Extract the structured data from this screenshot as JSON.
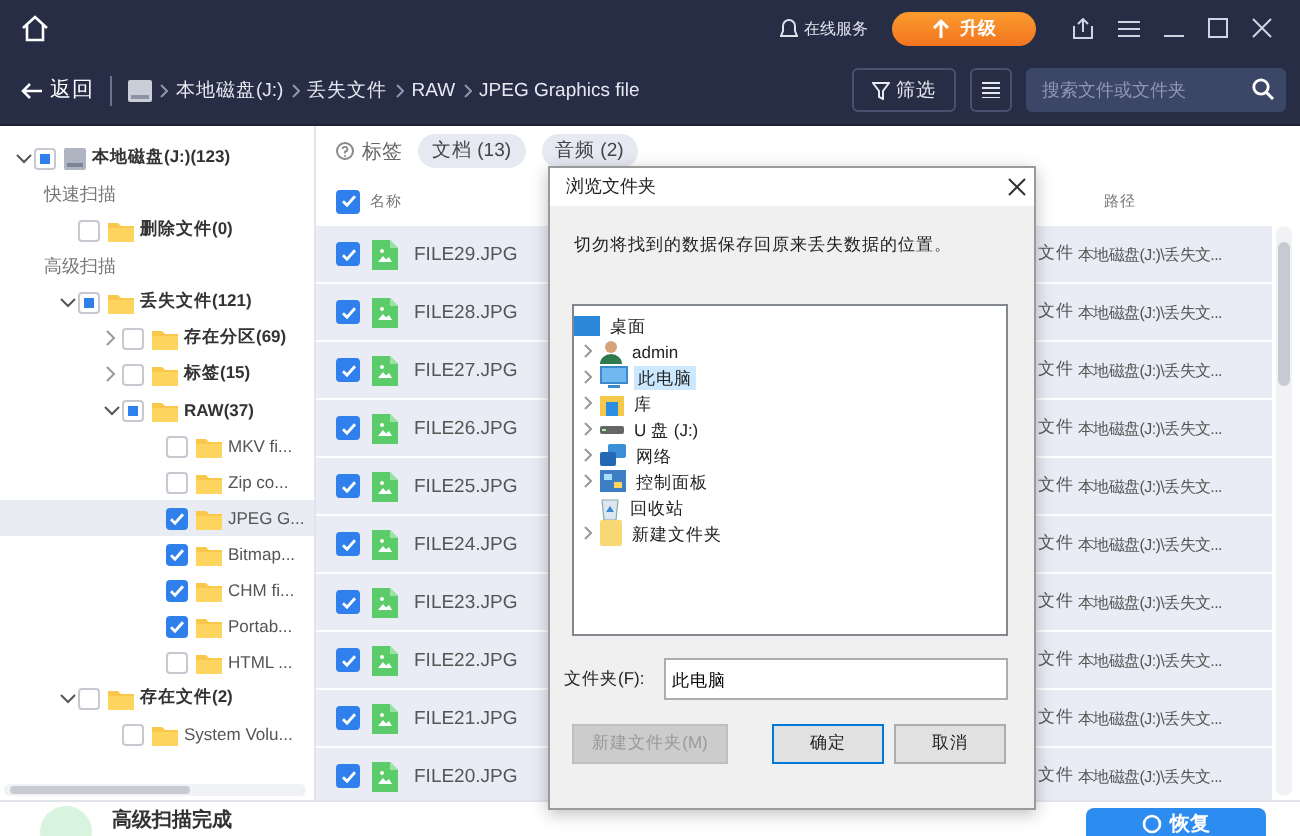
{
  "title_bar": {
    "service_label": "在线服务",
    "upgrade_button": "升级"
  },
  "nav": {
    "back": "返回",
    "breadcrumb": [
      "本地磁盘(J:)",
      "丢失文件",
      "RAW",
      "JPEG Graphics file"
    ],
    "filter_button": "筛选",
    "search": {
      "placeholder": "搜索文件或文件夹"
    }
  },
  "sidebar": {
    "root": {
      "label": "本地磁盘(J:)(123)",
      "checked": false,
      "partial": true,
      "expanded": true,
      "selected": false
    },
    "sections": [
      {
        "title": "快速扫描",
        "items": [
          {
            "label": "删除文件(0)",
            "checked": false,
            "partial": false,
            "selected": false
          }
        ]
      },
      {
        "title": "高级扫描",
        "items": [
          {
            "label": "丢失文件(121)",
            "checked": false,
            "partial": true,
            "expanded": true,
            "selected": false,
            "children": [
              {
                "label": "存在分区(69)",
                "checked": false,
                "partial": false,
                "expanded": false,
                "selected": false
              },
              {
                "label": "标签(15)",
                "checked": false,
                "partial": false,
                "expanded": false,
                "selected": false
              },
              {
                "label": "RAW(37)",
                "checked": false,
                "partial": true,
                "expanded": true,
                "selected": false,
                "children": [
                  {
                    "label": "MKV fi...",
                    "checked": false,
                    "partial": false,
                    "selected": false
                  },
                  {
                    "label": "Zip co...",
                    "checked": false,
                    "partial": false,
                    "selected": false
                  },
                  {
                    "label": "JPEG G...",
                    "checked": true,
                    "partial": false,
                    "selected": true
                  },
                  {
                    "label": "Bitmap...",
                    "checked": true,
                    "partial": false,
                    "selected": false
                  },
                  {
                    "label": "CHM fi...",
                    "checked": true,
                    "partial": false,
                    "selected": false
                  },
                  {
                    "label": "Portab...",
                    "checked": true,
                    "partial": false,
                    "selected": false
                  },
                  {
                    "label": "HTML ...",
                    "checked": false,
                    "partial": false,
                    "selected": false
                  }
                ]
              }
            ]
          },
          {
            "label": "存在文件(2)",
            "checked": false,
            "partial": false,
            "expanded": true,
            "selected": false,
            "children": [
              {
                "label": "System Volu...",
                "checked": false,
                "partial": false,
                "selected": false
              }
            ]
          }
        ]
      }
    ]
  },
  "tags": {
    "label": "标签",
    "chips": [
      "文档 (13)",
      "音频 (2)"
    ]
  },
  "table": {
    "select_all": true,
    "columns": {
      "name": "名称",
      "path": "路径"
    },
    "rows": [
      {
        "checked": true,
        "name": "FILE29.JPG",
        "type": "文件",
        "path": "本地磁盘(J:)\\丢失文..."
      },
      {
        "checked": true,
        "name": "FILE28.JPG",
        "type": "文件",
        "path": "本地磁盘(J:)\\丢失文..."
      },
      {
        "checked": true,
        "name": "FILE27.JPG",
        "type": "文件",
        "path": "本地磁盘(J:)\\丢失文..."
      },
      {
        "checked": true,
        "name": "FILE26.JPG",
        "type": "文件",
        "path": "本地磁盘(J:)\\丢失文..."
      },
      {
        "checked": true,
        "name": "FILE25.JPG",
        "type": "文件",
        "path": "本地磁盘(J:)\\丢失文..."
      },
      {
        "checked": true,
        "name": "FILE24.JPG",
        "type": "文件",
        "path": "本地磁盘(J:)\\丢失文..."
      },
      {
        "checked": true,
        "name": "FILE23.JPG",
        "type": "文件",
        "path": "本地磁盘(J:)\\丢失文..."
      },
      {
        "checked": true,
        "name": "FILE22.JPG",
        "type": "文件",
        "path": "本地磁盘(J:)\\丢失文..."
      },
      {
        "checked": true,
        "name": "FILE21.JPG",
        "type": "文件",
        "path": "本地磁盘(J:)\\丢失文..."
      },
      {
        "checked": true,
        "name": "FILE20.JPG",
        "type": "文件",
        "path": "本地磁盘(J:)\\丢失文..."
      }
    ]
  },
  "dialog": {
    "title": "浏览文件夹",
    "message": "切勿将找到的数据保存回原来丢失数据的位置。",
    "tree": {
      "label": "桌面",
      "kind": "desktop",
      "selected": false,
      "children": [
        {
          "label": "admin",
          "kind": "user",
          "expandable": true,
          "selected": false
        },
        {
          "label": "此电脑",
          "kind": "computer",
          "expandable": true,
          "selected": true
        },
        {
          "label": "库",
          "kind": "library",
          "expandable": true,
          "selected": false
        },
        {
          "label": "U 盘 (J:)",
          "kind": "drive",
          "expandable": true,
          "selected": false
        },
        {
          "label": "网络",
          "kind": "network",
          "expandable": true,
          "selected": false
        },
        {
          "label": "控制面板",
          "kind": "control-panel",
          "expandable": true,
          "selected": false
        },
        {
          "label": "回收站",
          "kind": "recycle-bin",
          "expandable": false,
          "selected": false
        },
        {
          "label": "新建文件夹",
          "kind": "folder",
          "expandable": true,
          "selected": false
        }
      ]
    },
    "folder_label": "文件夹(F):",
    "folder_value": "此电脑",
    "buttons": [
      {
        "label": "新建文件夹(M)",
        "disabled": true,
        "default": false
      },
      {
        "label": "确定",
        "disabled": false,
        "default": true
      },
      {
        "label": "取消",
        "disabled": false,
        "default": false
      }
    ]
  },
  "footer": {
    "status": "高级扫描完成",
    "recover_button": "恢复"
  }
}
